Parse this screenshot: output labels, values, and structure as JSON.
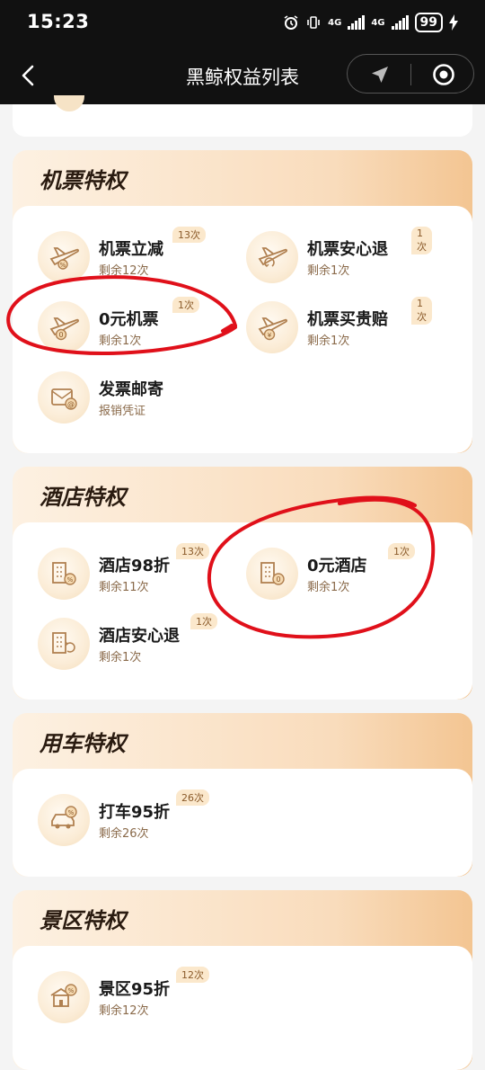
{
  "status": {
    "time": "15:23",
    "net1": "4G",
    "net2": "4G",
    "battery": "99"
  },
  "nav": {
    "title": "黑鲸权益列表"
  },
  "sections": [
    {
      "title": "机票特权",
      "items": [
        {
          "name": "机票立减",
          "sub": "剩余12次",
          "badge": "13次",
          "icon": "plane-discount-icon"
        },
        {
          "name": "机票安心退",
          "sub": "剩余1次",
          "badge": "1次",
          "icon": "plane-refund-icon"
        },
        {
          "name": "0元机票",
          "sub": "剩余1次",
          "badge": "1次",
          "icon": "plane-coin-icon"
        },
        {
          "name": "机票买贵赔",
          "sub": "剩余1次",
          "badge": "1次",
          "icon": "plane-yen-icon"
        },
        {
          "name": "发票邮寄",
          "sub": "报销凭证",
          "badge": "",
          "icon": "invoice-mail-icon"
        }
      ]
    },
    {
      "title": "酒店特权",
      "items": [
        {
          "name": "酒店98折",
          "sub": "剩余11次",
          "badge": "13次",
          "icon": "hotel-discount-icon"
        },
        {
          "name": "0元酒店",
          "sub": "剩余1次",
          "badge": "1次",
          "icon": "hotel-coin-icon"
        },
        {
          "name": "酒店安心退",
          "sub": "剩余1次",
          "badge": "1次",
          "icon": "hotel-refund-icon"
        }
      ]
    },
    {
      "title": "用车特权",
      "items": [
        {
          "name": "打车95折",
          "sub": "剩余26次",
          "badge": "26次",
          "icon": "car-discount-icon"
        }
      ]
    },
    {
      "title": "景区特权",
      "items": [
        {
          "name": "景区95折",
          "sub": "剩余12次",
          "badge": "12次",
          "icon": "scenic-discount-icon"
        }
      ]
    }
  ],
  "colors": {
    "accent": "#c08a4a",
    "annotation": "#e0101a",
    "header_bg": "#111111"
  }
}
